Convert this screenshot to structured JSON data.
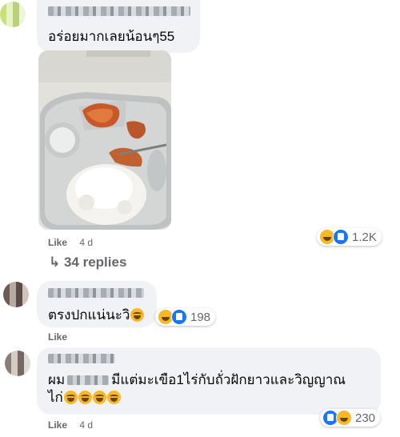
{
  "comments": [
    {
      "text": "อร่อยมากเลยน้อนๆ55",
      "like_label": "Like",
      "time": "4 d",
      "reaction_count": "1.2K",
      "replies_label": "↳ 34 replies"
    },
    {
      "text": "ตรงปกแน่นะวิ",
      "reaction_count": "198",
      "like_label": "Like"
    },
    {
      "text_line1_prefix": "ผม",
      "text_line1_suffix": "มีแต่มะเขือ1ไร่กับถั่วฝักยาวและวิญญาณ",
      "text_line2": "ไก่",
      "like_label": "Like",
      "time": "4 d",
      "reaction_count": "230"
    }
  ],
  "colors": {
    "bubble": "#f0f2f5",
    "text": "#050505",
    "meta": "#65676b",
    "like_reaction": "#1877f2",
    "haha_reaction": "#f7b928"
  },
  "icons": [
    "haha-reaction-icon",
    "like-reaction-icon",
    "reply-arrow-icon",
    "laughing-emoji-icon"
  ]
}
